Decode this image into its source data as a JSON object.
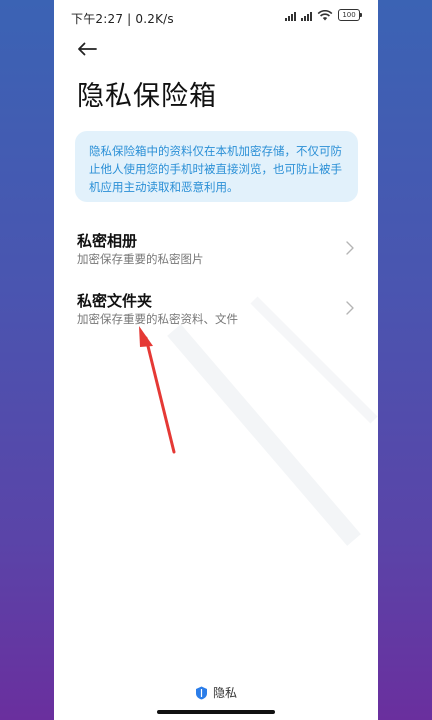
{
  "status_bar": {
    "time": "下午2:27 | 0.2K/s",
    "battery": "100"
  },
  "header": {
    "title": "隐私保险箱"
  },
  "info": {
    "text": "隐私保险箱中的资料仅在本机加密存储，不仅可防止他人使用您的手机时被直接浏览，也可防止被手机应用主动读取和恶意利用。"
  },
  "items": [
    {
      "title": "私密相册",
      "subtitle": "加密保存重要的私密图片"
    },
    {
      "title": "私密文件夹",
      "subtitle": "加密保存重要的私密资料、文件"
    }
  ],
  "footer": {
    "brand": "隐私"
  },
  "colors": {
    "info_bg": "#e2f1fb",
    "info_text": "#2a8fd6",
    "annotation_arrow": "#e53935",
    "brand_icon": "#2b7de9"
  }
}
